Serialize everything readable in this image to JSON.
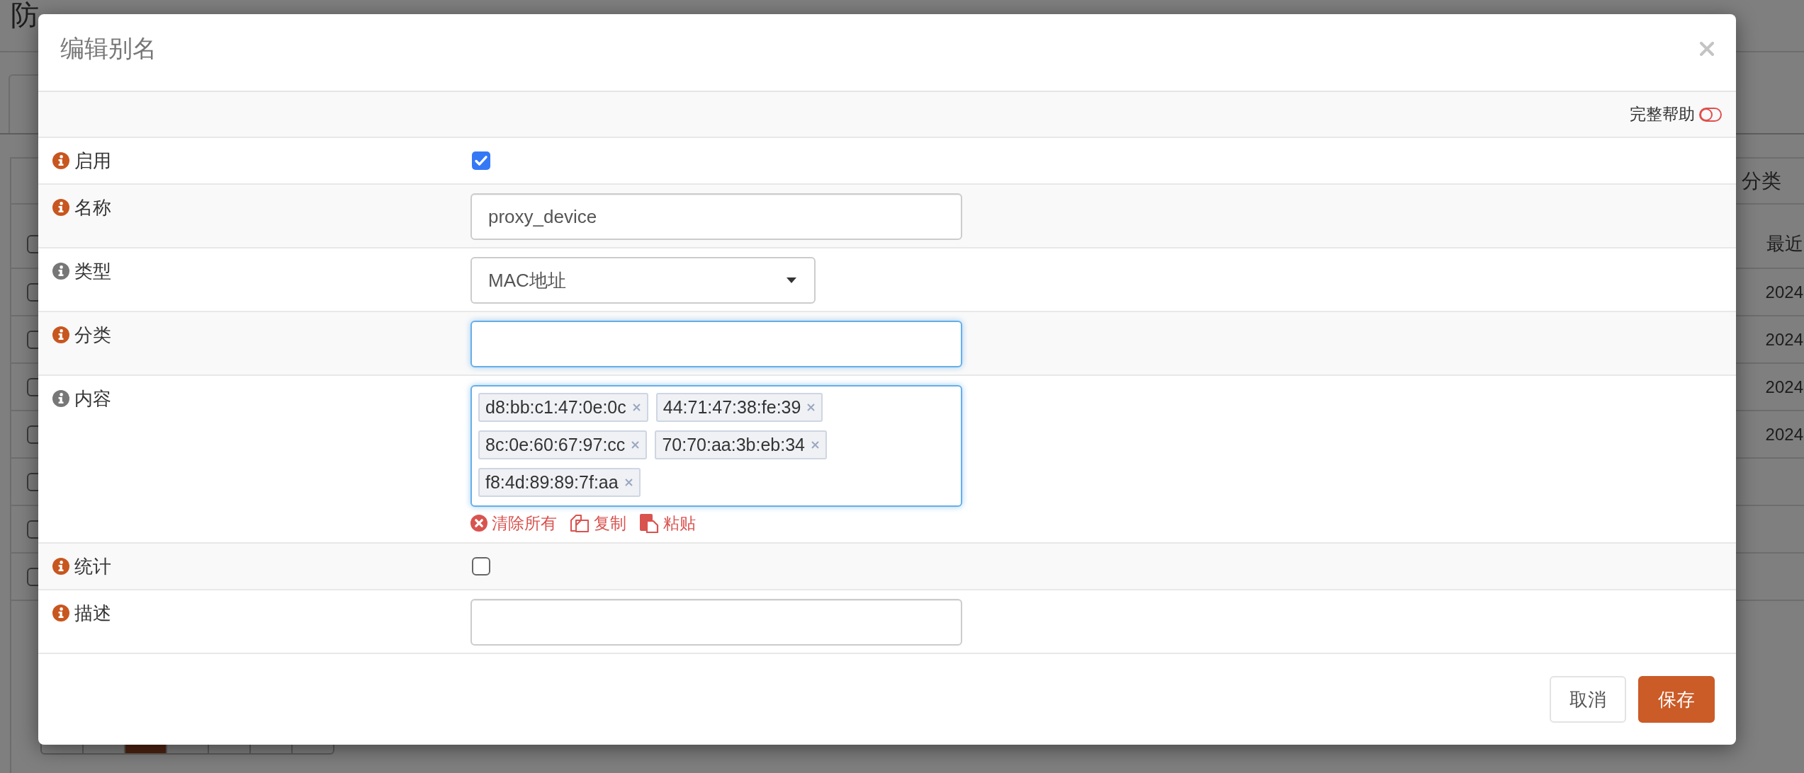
{
  "background": {
    "title": "防",
    "filter_label": "分类",
    "table": {
      "header_checked": false,
      "header": "最近",
      "rows": [
        {
          "checked": false,
          "cell": "2024"
        },
        {
          "checked": false,
          "cell": "2024"
        },
        {
          "checked": false,
          "cell": "2024"
        },
        {
          "checked": false,
          "cell": "2024"
        },
        {
          "checked": false
        },
        {
          "checked": false
        },
        {
          "checked": false
        }
      ]
    },
    "pagination": [
      {
        "selected": false
      },
      {
        "selected": false
      },
      {
        "selected": true
      },
      {
        "selected": false
      },
      {
        "selected": false
      },
      {
        "selected": false
      },
      {
        "selected": false
      }
    ]
  },
  "dialog": {
    "title": "编辑别名",
    "help": {
      "label": "完整帮助",
      "on": false
    },
    "fields": [
      {
        "kind": "checkbox",
        "label": "启用",
        "color": "#c8561f",
        "checked": true
      },
      {
        "kind": "text",
        "label": "名称",
        "color": "#c8561f",
        "value": "proxy_device",
        "focused": false
      },
      {
        "kind": "select",
        "label": "类型",
        "color": "#777777",
        "value": "MAC地址"
      },
      {
        "kind": "text",
        "label": "分类",
        "color": "#c8561f",
        "focused": true
      },
      {
        "kind": "tags",
        "label": "内容",
        "color": "#777777",
        "focused": true,
        "tags": [
          "d8:bb:c1:47:0e:0c",
          "44:71:47:38:fe:39",
          "8c:0e:60:67:97:cc",
          "70:70:aa:3b:eb:34",
          "f8:4d:89:89:7f:aa"
        ],
        "actions": [
          {
            "kind": "clear",
            "label": "清除所有"
          },
          {
            "kind": "copy",
            "label": "复制"
          },
          {
            "kind": "paste",
            "label": "粘贴"
          }
        ]
      },
      {
        "kind": "checkbox",
        "label": "统计",
        "color": "#c8561f",
        "checked": false
      },
      {
        "kind": "text",
        "label": "描述",
        "color": "#c8561f",
        "focused": false
      }
    ],
    "buttons": [
      {
        "kind": "secondary",
        "label": "取消"
      },
      {
        "kind": "primary",
        "label": "保存"
      }
    ]
  }
}
